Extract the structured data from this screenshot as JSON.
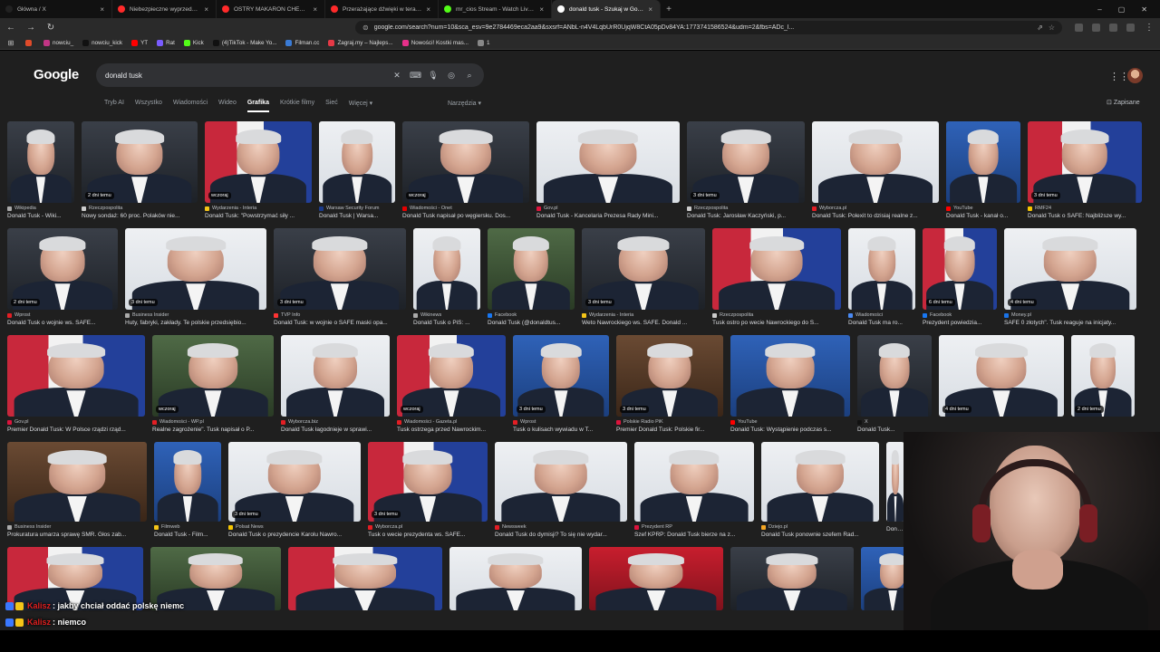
{
  "browser": {
    "tabs": [
      {
        "title": "Główna / X",
        "color": "#222222",
        "active": false,
        "width": 124
      },
      {
        "title": "Niebezpieczne wyprzedzanie kie",
        "color": "#ff2a2a",
        "active": false,
        "width": 115
      },
      {
        "title": "OSTRY MAKARON CHEETOS - TEST",
        "color": "#ff2a2a",
        "active": false,
        "width": 120
      },
      {
        "title": "Przerażające dźwięki w terapii mani",
        "color": "#ff2a2a",
        "active": false,
        "width": 125
      },
      {
        "title": "mr_cios Stream - Watch Live on Kick",
        "color": "#53fc18",
        "active": false,
        "width": 125
      },
      {
        "title": "donald tusk - Szukaj w Google",
        "color": "#ffffff",
        "active": true,
        "width": 120
      }
    ],
    "new_tab": "+",
    "window_controls": {
      "minimize": "–",
      "maximize": "▢",
      "close": "✕"
    },
    "address": "google.com/search?num=10&sca_esv=9e2784469eca2aa9&sxsrf=ANbL-n4V4LqbUrR0UjqW8CtA05pDv84YA:1773741586524&udm=2&fbs=ADc_l...",
    "bookmarks": [
      {
        "label": "",
        "color": "#e04b2a"
      },
      {
        "label": "nowciu_",
        "color": "#c13584"
      },
      {
        "label": "nowciu_kick",
        "color": "#111111"
      },
      {
        "label": "YT",
        "color": "#ff0000"
      },
      {
        "label": "Rat",
        "color": "#7a5cff"
      },
      {
        "label": "Kick",
        "color": "#53fc18"
      },
      {
        "label": "(4)TikTok - Make Yo...",
        "color": "#111111"
      },
      {
        "label": "Filman.cc",
        "color": "#3a7bd5"
      },
      {
        "label": "Zagraj.my – Najleps...",
        "color": "#e63946"
      },
      {
        "label": "Nowości! Kostki mas...",
        "color": "#e6308a"
      },
      {
        "label": "1",
        "color": "#888888"
      }
    ]
  },
  "google": {
    "logo": "Google",
    "query": "donald tusk",
    "filters": [
      "Tryb AI",
      "Wszystko",
      "Wiadomości",
      "Wideo",
      "Grafika",
      "Krótkie filmy",
      "Sieć",
      "Więcej ▾"
    ],
    "active_filter": "Grafika",
    "tools": "Narzędzia ▾",
    "saved": "Zapisane",
    "rows": [
      {
        "h": 90,
        "items": [
          {
            "w": 74,
            "bg": "dark",
            "badge": "",
            "src": "Wikipedia",
            "src_color": "#aaaaaa",
            "caption": "Donald Tusk - Wiki..."
          },
          {
            "w": 128,
            "bg": "dark",
            "badge": "2 dni temu",
            "src": "Rzeczpospolita",
            "src_color": "#cccccc",
            "caption": "Nowy sondaż: 60 proc. Polaków nie..."
          },
          {
            "w": 118,
            "bg": "flag",
            "badge": "wczoraj",
            "src": "Wydarzenia - Interia",
            "src_color": "#f5c518",
            "caption": "Donald Tusk: \"Powstrzymać siły ..."
          },
          {
            "w": 84,
            "bg": "white",
            "badge": "",
            "src": "Warsaw Security Forum",
            "src_color": "#1a3a8a",
            "caption": "Donald Tusk | Warsa..."
          },
          {
            "w": 140,
            "bg": "dark",
            "badge": "wczoraj",
            "src": "Wiadomości - Onet",
            "src_color": "#e60000",
            "caption": "Donald Tusk napisał po węgiersku. Dos..."
          },
          {
            "w": 158,
            "bg": "white",
            "badge": "",
            "src": "Gov.pl",
            "src_color": "#dc143c",
            "caption": "Donald Tusk - Kancelaria Prezesa Rady Mini..."
          },
          {
            "w": 130,
            "bg": "dark",
            "badge": "3 dni temu",
            "src": "Rzeczpospolita",
            "src_color": "#cccccc",
            "caption": "Donald Tusk: Jarosław Kaczyński, p..."
          },
          {
            "w": 140,
            "bg": "white",
            "badge": "",
            "src": "Wyborcza.pl",
            "src_color": "#e31e24",
            "caption": "Donald Tusk: Polexit to dzisiaj realne z..."
          },
          {
            "w": 82,
            "bg": "blue",
            "badge": "",
            "src": "YouTube",
            "src_color": "#ff0000",
            "caption": "Donald Tusk - kanał o..."
          },
          {
            "w": 126,
            "bg": "flag",
            "badge": "3 dni temu",
            "src": "RMF24",
            "src_color": "#f7c600",
            "caption": "Donald Tusk o SAFE: Najbliższe wy..."
          }
        ]
      },
      {
        "h": 90,
        "items": [
          {
            "w": 122,
            "bg": "dark",
            "badge": "2 dni temu",
            "src": "Wprost",
            "src_color": "#e31e24",
            "caption": "Donald Tusk o wojnie ws. SAFE..."
          },
          {
            "w": 156,
            "bg": "white",
            "badge": "3 dni temu",
            "src": "Business Insider",
            "src_color": "#aaaaaa",
            "caption": "Huty, fabryki, zakłady. Te polskie przedsiębio..."
          },
          {
            "w": 146,
            "bg": "dark",
            "badge": "3 dni temu",
            "src": "TVP Info",
            "src_color": "#ff3333",
            "caption": "Donald Tusk: w wojnie o SAFE maski opa..."
          },
          {
            "w": 74,
            "bg": "white",
            "badge": "",
            "src": "Wikinews",
            "src_color": "#aaaaaa",
            "caption": "Donald Tusk o PiS: ..."
          },
          {
            "w": 96,
            "bg": "green",
            "badge": "",
            "src": "Facebook",
            "src_color": "#1877f2",
            "caption": "Donald Tusk (@donaldtus..."
          },
          {
            "w": 136,
            "bg": "dark",
            "badge": "3 dni temu",
            "src": "Wydarzenia - Interia",
            "src_color": "#f5c518",
            "caption": "Weto Nawrockiego ws. SAFE. Donald ..."
          },
          {
            "w": 142,
            "bg": "flag",
            "badge": "",
            "src": "Rzeczpospolita",
            "src_color": "#cccccc",
            "caption": "Tusk ostro po wecie Nawrockiego do S..."
          },
          {
            "w": 74,
            "bg": "white",
            "badge": "",
            "src": "Wiadomości",
            "src_color": "#4a8af4",
            "caption": "Donald Tusk ma ro..."
          },
          {
            "w": 82,
            "bg": "flag",
            "badge": "6 dni temu",
            "src": "Facebook",
            "src_color": "#1877f2",
            "caption": "Prezydent powiedzia..."
          },
          {
            "w": 146,
            "bg": "white",
            "badge": "4 dni temu",
            "src": "Money.pl",
            "src_color": "#1a73e8",
            "caption": "SAFE 0 złotych\". Tusk reaguje na inicjaty..."
          }
        ]
      },
      {
        "h": 90,
        "items": [
          {
            "w": 152,
            "bg": "flag",
            "badge": "",
            "src": "Gov.pl",
            "src_color": "#dc143c",
            "caption": "Premier Donald Tusk: W Polsce rządzi rząd..."
          },
          {
            "w": 134,
            "bg": "green",
            "badge": "wczoraj",
            "src": "Wiadomości - WP.pl",
            "src_color": "#e31e24",
            "caption": "Realne zagrożenie\". Tusk napisał o P..."
          },
          {
            "w": 120,
            "bg": "white",
            "badge": "",
            "src": "Wyborcza.biz",
            "src_color": "#e31e24",
            "caption": "Donald Tusk łagodnieje w sprawi..."
          },
          {
            "w": 120,
            "bg": "flag",
            "badge": "wczoraj",
            "src": "Wiadomości - Gazeta.pl",
            "src_color": "#e31e24",
            "caption": "Tusk ostrzega przed Nawrockim..."
          },
          {
            "w": 106,
            "bg": "blue",
            "badge": "3 dni temu",
            "src": "Wprost",
            "src_color": "#e31e24",
            "caption": "Tusk o kulisach wywiadu w T..."
          },
          {
            "w": 118,
            "bg": "brown",
            "badge": "3 dni temu",
            "src": "Polskie Radio PiK",
            "src_color": "#dc143c",
            "caption": "Premier Donald Tusk: Polskie fir..."
          },
          {
            "w": 132,
            "bg": "blue",
            "badge": "",
            "src": "YouTube",
            "src_color": "#ff0000",
            "caption": "Donald Tusk: Wystąpienie podczas s..."
          },
          {
            "w": 82,
            "bg": "dark",
            "badge": "",
            "src": "X",
            "src_color": "#111111",
            "caption": "Donald Tusk..."
          },
          {
            "w": 138,
            "bg": "white",
            "badge": "4 dni temu",
            "src": "",
            "src_color": "#aaaaaa",
            "caption": ""
          },
          {
            "w": 70,
            "bg": "white",
            "badge": "2 dni temu",
            "src": "",
            "src_color": "#aaaaaa",
            "caption": ""
          }
        ]
      },
      {
        "h": 88,
        "items": [
          {
            "w": 154,
            "bg": "brown",
            "badge": "",
            "src": "Business Insider",
            "src_color": "#aaaaaa",
            "caption": "Prokuratura umarza sprawę SMR. Głos zab..."
          },
          {
            "w": 74,
            "bg": "blue",
            "badge": "",
            "src": "Filmweb",
            "src_color": "#f5c518",
            "caption": "Donald Tusk - Film..."
          },
          {
            "w": 146,
            "bg": "white",
            "badge": "3 dni temu",
            "src": "Polsat News",
            "src_color": "#f7c600",
            "caption": "Donald Tusk o prezydencie Karolu Nawro..."
          },
          {
            "w": 132,
            "bg": "flag",
            "badge": "3 dni temu",
            "src": "Wyborcza.pl",
            "src_color": "#e31e24",
            "caption": "Tusk o wecie prezydenta ws. SAFE..."
          },
          {
            "w": 146,
            "bg": "white",
            "badge": "",
            "src": "Newsweek",
            "src_color": "#e31e24",
            "caption": "Donald Tusk do dymisji? To się nie wydar..."
          },
          {
            "w": 132,
            "bg": "white",
            "badge": "",
            "src": "Prezydent RP",
            "src_color": "#dc143c",
            "caption": "Szef KPRP: Donald Tusk bierze na z..."
          },
          {
            "w": 130,
            "bg": "white",
            "badge": "",
            "src": "Dziejo.pl",
            "src_color": "#f5a623",
            "caption": "Donald Tusk ponownie szefem Rad..."
          },
          {
            "w": 20,
            "bg": "white",
            "badge": "",
            "src": "",
            "src_color": "#aaaaaa",
            "caption": "Dona..."
          }
        ]
      },
      {
        "h": 70,
        "items": [
          {
            "w": 150,
            "bg": "flag",
            "badge": "",
            "src": "",
            "src_color": "#aaaaaa",
            "caption": ""
          },
          {
            "w": 144,
            "bg": "green",
            "badge": "",
            "src": "",
            "src_color": "#aaaaaa",
            "caption": ""
          },
          {
            "w": 170,
            "bg": "flag",
            "badge": "",
            "src": "",
            "src_color": "#aaaaaa",
            "caption": ""
          },
          {
            "w": 146,
            "bg": "white",
            "badge": "",
            "src": "",
            "src_color": "#aaaaaa",
            "caption": ""
          },
          {
            "w": 148,
            "bg": "red",
            "badge": "",
            "src": "",
            "src_color": "#aaaaaa",
            "caption": ""
          },
          {
            "w": 136,
            "bg": "dark",
            "badge": "",
            "src": "",
            "src_color": "#aaaaaa",
            "caption": ""
          },
          {
            "w": 70,
            "bg": "blue",
            "badge": "",
            "src": "",
            "src_color": "#aaaaaa",
            "caption": ""
          }
        ]
      }
    ]
  },
  "chat": [
    {
      "user": "Kalisz",
      "message": ": jakby chciał oddać polskę niemc",
      "badge_colors": [
        "#3a78ff",
        "#f5c518"
      ]
    },
    {
      "user": "Kalisz",
      "message": ": niemco",
      "badge_colors": [
        "#3a78ff",
        "#f5c518"
      ]
    }
  ]
}
